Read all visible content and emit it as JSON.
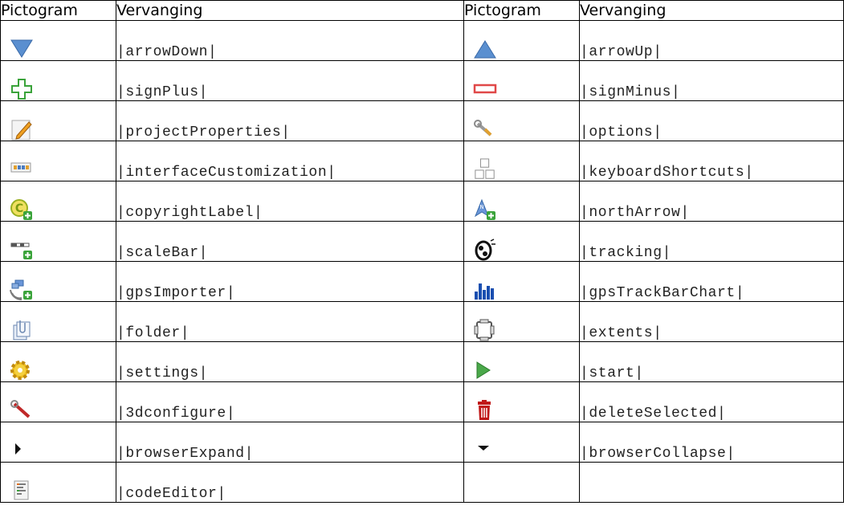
{
  "headers": {
    "left_icon": "Pictogram",
    "left_code": "Vervanging",
    "right_icon": "Pictogram",
    "right_code": "Vervanging"
  },
  "rows": [
    {
      "left": {
        "icon": "arrow-down-icon",
        "code": "|arrowDown|"
      },
      "right": {
        "icon": "arrow-up-icon",
        "code": "|arrowUp|"
      }
    },
    {
      "left": {
        "icon": "sign-plus-icon",
        "code": "|signPlus|"
      },
      "right": {
        "icon": "sign-minus-icon",
        "code": "|signMinus|"
      }
    },
    {
      "left": {
        "icon": "project-properties-icon",
        "code": "|projectProperties|"
      },
      "right": {
        "icon": "options-icon",
        "code": "|options|"
      }
    },
    {
      "left": {
        "icon": "interface-customization-icon",
        "code": "|interfaceCustomization|"
      },
      "right": {
        "icon": "keyboard-shortcuts-icon",
        "code": "|keyboardShortcuts|"
      }
    },
    {
      "left": {
        "icon": "copyright-label-icon",
        "code": "|copyrightLabel|"
      },
      "right": {
        "icon": "north-arrow-icon",
        "code": "|northArrow|"
      }
    },
    {
      "left": {
        "icon": "scale-bar-icon",
        "code": "|scaleBar|"
      },
      "right": {
        "icon": "tracking-icon",
        "code": "|tracking|"
      }
    },
    {
      "left": {
        "icon": "gps-importer-icon",
        "code": "|gpsImporter|"
      },
      "right": {
        "icon": "gps-track-bar-chart-icon",
        "code": "|gpsTrackBarChart|"
      }
    },
    {
      "left": {
        "icon": "folder-icon",
        "code": "|folder|"
      },
      "right": {
        "icon": "extents-icon",
        "code": "|extents|"
      }
    },
    {
      "left": {
        "icon": "settings-icon",
        "code": "|settings|"
      },
      "right": {
        "icon": "start-icon",
        "code": "|start|"
      }
    },
    {
      "left": {
        "icon": "3d-configure-icon",
        "code": "|3dconfigure|"
      },
      "right": {
        "icon": "delete-selected-icon",
        "code": "|deleteSelected|"
      }
    },
    {
      "left": {
        "icon": "browser-expand-icon",
        "code": "|browserExpand|"
      },
      "right": {
        "icon": "browser-collapse-icon",
        "code": "|browserCollapse|"
      }
    },
    {
      "left": {
        "icon": "code-editor-icon",
        "code": "|codeEditor|"
      },
      "right": {
        "icon": "",
        "code": ""
      }
    }
  ]
}
